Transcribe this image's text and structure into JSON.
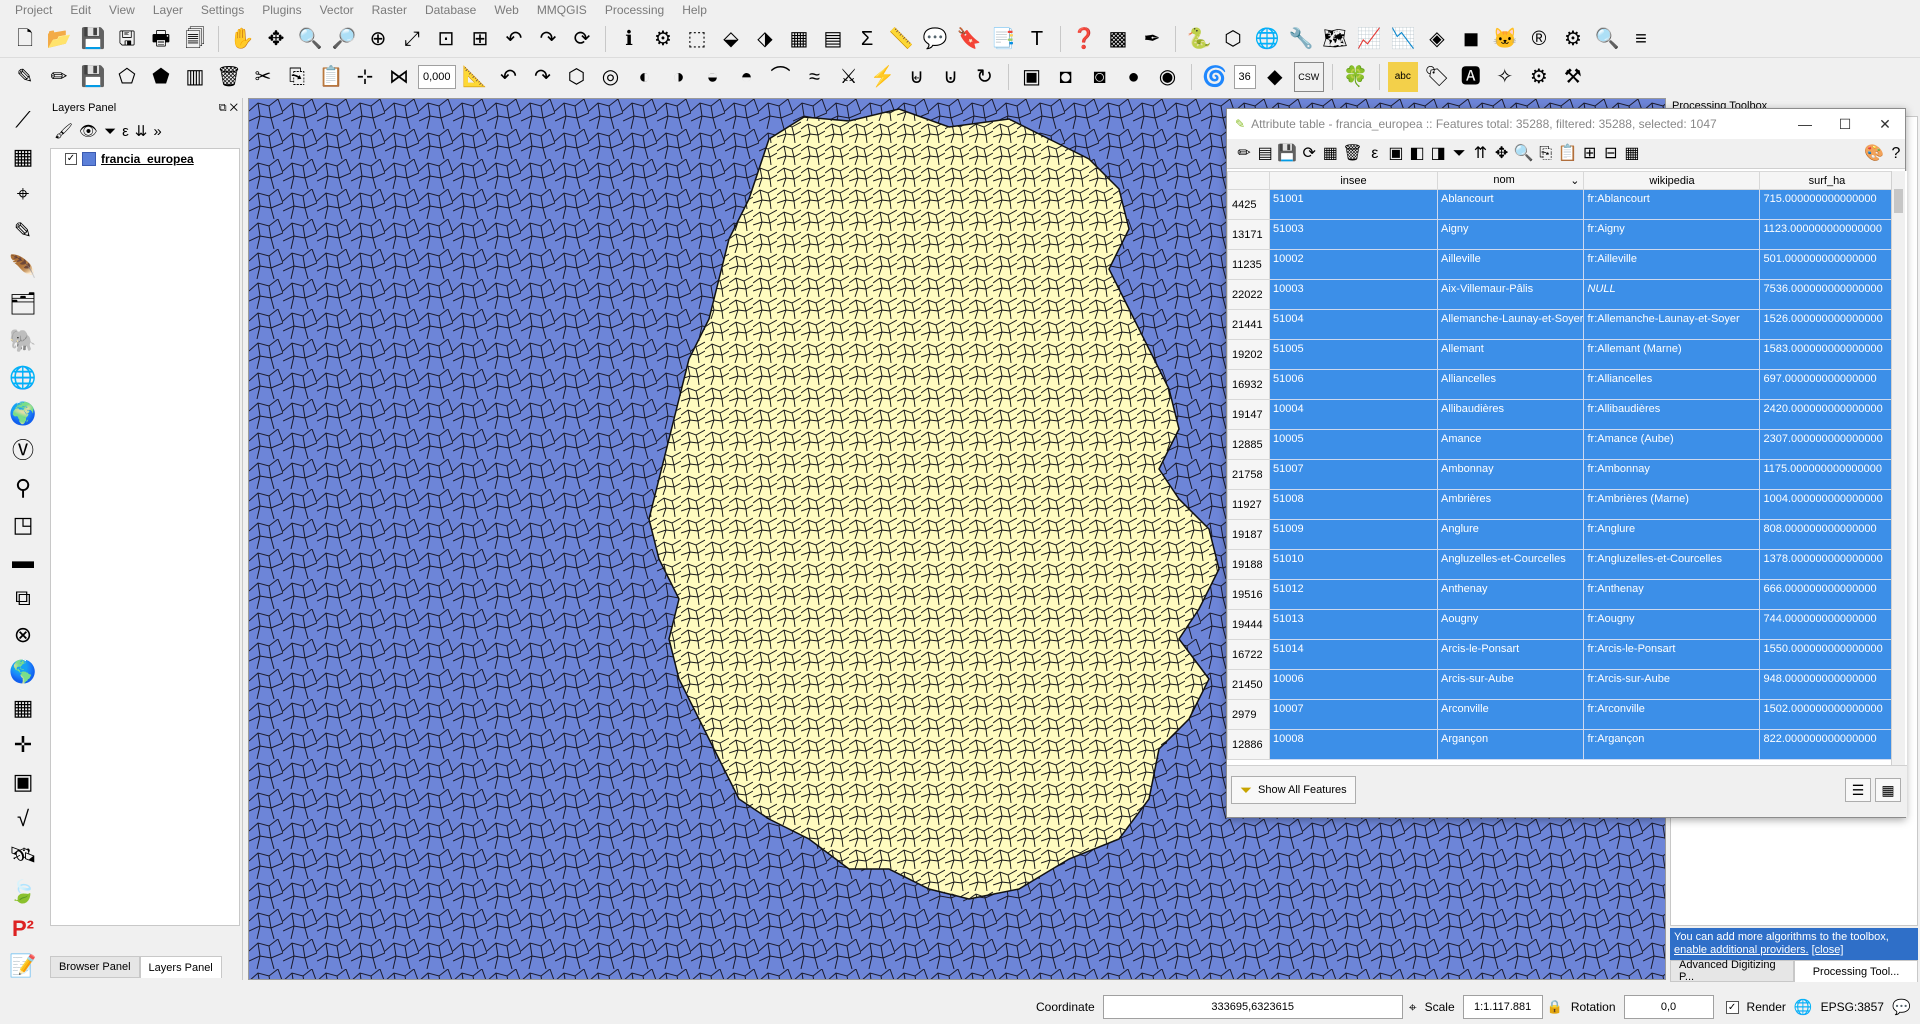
{
  "menubar": {
    "items": [
      "Project",
      "Edit",
      "View",
      "Layer",
      "Settings",
      "Plugins",
      "Vector",
      "Raster",
      "Database",
      "Web",
      "MMQGIS",
      "Processing",
      "Help"
    ]
  },
  "toolbar2": {
    "snap_tolerance": "0,000",
    "label_size": "36",
    "csw_label": "CSW",
    "abc_label": "abc"
  },
  "layers_panel": {
    "title": "Layers Panel",
    "layer_name": "francia_europea",
    "tabs": [
      "Browser Panel",
      "Layers Panel"
    ]
  },
  "processing_toolbox": {
    "title": "Processing Toolbox",
    "info_text": "You can add more algorithms to the toolbox,",
    "info_link": "enable additional providers.",
    "info_close": "[close]",
    "tabs": [
      "Advanced Digitizing P...",
      "Processing Tool..."
    ]
  },
  "attribute_table": {
    "title": "Attribute table - francia_europea :: Features total: 35288, filtered: 35288, selected: 1047",
    "columns": [
      "insee",
      "nom",
      "wikipedia",
      "surf_ha"
    ],
    "rows": [
      {
        "id": "4425",
        "insee": "51001",
        "nom": "Ablancourt",
        "wikipedia": "fr:Ablancourt",
        "surf_ha": "715.000000000000000"
      },
      {
        "id": "13171",
        "insee": "51003",
        "nom": "Aigny",
        "wikipedia": "fr:Aigny",
        "surf_ha": "1123.000000000000000"
      },
      {
        "id": "11235",
        "insee": "10002",
        "nom": "Ailleville",
        "wikipedia": "fr:Ailleville",
        "surf_ha": "501.000000000000000"
      },
      {
        "id": "22022",
        "insee": "10003",
        "nom": "Aix-Villemaur-Pâlis",
        "wikipedia": "NULL",
        "surf_ha": "7536.000000000000000"
      },
      {
        "id": "21441",
        "insee": "51004",
        "nom": "Allemanche-Launay-et-Soyer",
        "wikipedia": "fr:Allemanche-Launay-et-Soyer",
        "surf_ha": "1526.000000000000000"
      },
      {
        "id": "19202",
        "insee": "51005",
        "nom": "Allemant",
        "wikipedia": "fr:Allemant (Marne)",
        "surf_ha": "1583.000000000000000"
      },
      {
        "id": "16932",
        "insee": "51006",
        "nom": "Alliancelles",
        "wikipedia": "fr:Alliancelles",
        "surf_ha": "697.000000000000000"
      },
      {
        "id": "19147",
        "insee": "10004",
        "nom": "Allibaudières",
        "wikipedia": "fr:Allibaudières",
        "surf_ha": "2420.000000000000000"
      },
      {
        "id": "12885",
        "insee": "10005",
        "nom": "Amance",
        "wikipedia": "fr:Amance (Aube)",
        "surf_ha": "2307.000000000000000"
      },
      {
        "id": "21758",
        "insee": "51007",
        "nom": "Ambonnay",
        "wikipedia": "fr:Ambonnay",
        "surf_ha": "1175.000000000000000"
      },
      {
        "id": "11927",
        "insee": "51008",
        "nom": "Ambrières",
        "wikipedia": "fr:Ambrières (Marne)",
        "surf_ha": "1004.000000000000000"
      },
      {
        "id": "19187",
        "insee": "51009",
        "nom": "Anglure",
        "wikipedia": "fr:Anglure",
        "surf_ha": "808.000000000000000"
      },
      {
        "id": "19188",
        "insee": "51010",
        "nom": "Angluzelles-et-Courcelles",
        "wikipedia": "fr:Angluzelles-et-Courcelles",
        "surf_ha": "1378.000000000000000"
      },
      {
        "id": "19516",
        "insee": "51012",
        "nom": "Anthenay",
        "wikipedia": "fr:Anthenay",
        "surf_ha": "666.000000000000000"
      },
      {
        "id": "19444",
        "insee": "51013",
        "nom": "Aougny",
        "wikipedia": "fr:Aougny",
        "surf_ha": "744.000000000000000"
      },
      {
        "id": "16722",
        "insee": "51014",
        "nom": "Arcis-le-Ponsart",
        "wikipedia": "fr:Arcis-le-Ponsart",
        "surf_ha": "1550.000000000000000"
      },
      {
        "id": "21450",
        "insee": "10006",
        "nom": "Arcis-sur-Aube",
        "wikipedia": "fr:Arcis-sur-Aube",
        "surf_ha": "948.000000000000000"
      },
      {
        "id": "2979",
        "insee": "10007",
        "nom": "Arconville",
        "wikipedia": "fr:Arconville",
        "surf_ha": "1502.000000000000000"
      },
      {
        "id": "12886",
        "insee": "10008",
        "nom": "Argançon",
        "wikipedia": "fr:Argançon",
        "surf_ha": "822.000000000000000"
      }
    ],
    "show_all_label": "Show All Features"
  },
  "statusbar": {
    "coordinate_label": "Coordinate",
    "coordinate_value": "333695,6323615",
    "scale_label": "Scale",
    "scale_value": "1:1.117.881",
    "rotation_label": "Rotation",
    "rotation_value": "0,0",
    "render_label": "Render",
    "crs_value": "EPSG:3857"
  },
  "colors": {
    "map_background": "#6d85d8",
    "selected_region": "#fffbbf",
    "selection_highlight": "#3c8fe8"
  }
}
